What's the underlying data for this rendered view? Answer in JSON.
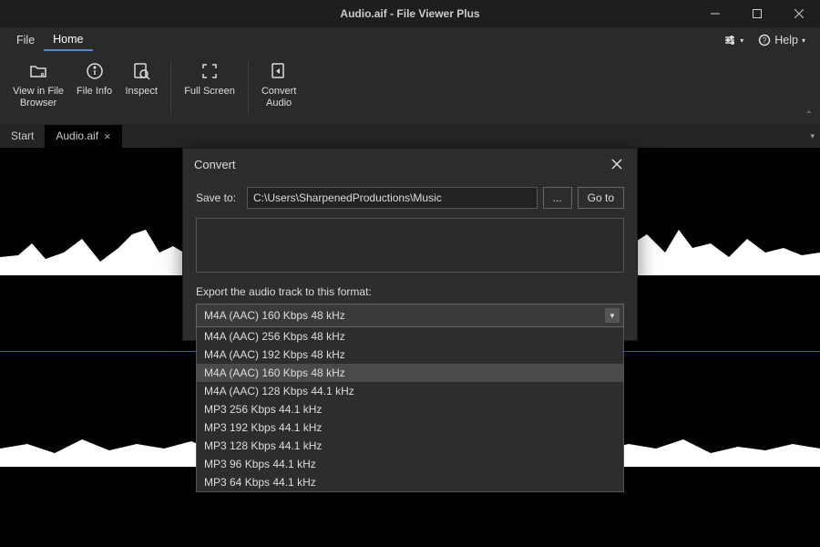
{
  "window": {
    "title": "Audio.aif - File Viewer Plus"
  },
  "menubar": {
    "items": [
      "File",
      "Home"
    ],
    "active": 1,
    "help": "Help"
  },
  "ribbon": {
    "buttons": [
      {
        "label": "View in File\nBrowser",
        "icon": "folder-arrow"
      },
      {
        "label": "File Info",
        "icon": "info"
      },
      {
        "label": "Inspect",
        "icon": "inspect"
      },
      {
        "label": "Full Screen",
        "icon": "fullscreen"
      },
      {
        "label": "Convert\nAudio",
        "icon": "convert"
      }
    ]
  },
  "tabs": {
    "items": [
      {
        "label": "Start",
        "closable": false
      },
      {
        "label": "Audio.aif",
        "closable": true
      }
    ],
    "active": 1
  },
  "dialog": {
    "title": "Convert",
    "save_to_label": "Save to:",
    "save_to_path": "C:\\Users\\SharpenedProductions\\Music",
    "browse_label": "...",
    "goto_label": "Go to",
    "format_label": "Export the audio track to this format:",
    "selected_format": "M4A (AAC) 160 Kbps 48 kHz",
    "format_options": [
      "M4A (AAC) 256 Kbps 48 kHz",
      "M4A (AAC) 192 Kbps 48 kHz",
      "M4A (AAC) 160 Kbps 48 kHz",
      "M4A (AAC) 128 Kbps 44.1 kHz",
      "MP3 256 Kbps 44.1 kHz",
      "MP3 192 Kbps 44.1 kHz",
      "MP3 128 Kbps 44.1 kHz",
      "MP3 96 Kbps 44.1 kHz",
      "MP3 64 Kbps 44.1 kHz"
    ],
    "highlighted_option": 2
  }
}
